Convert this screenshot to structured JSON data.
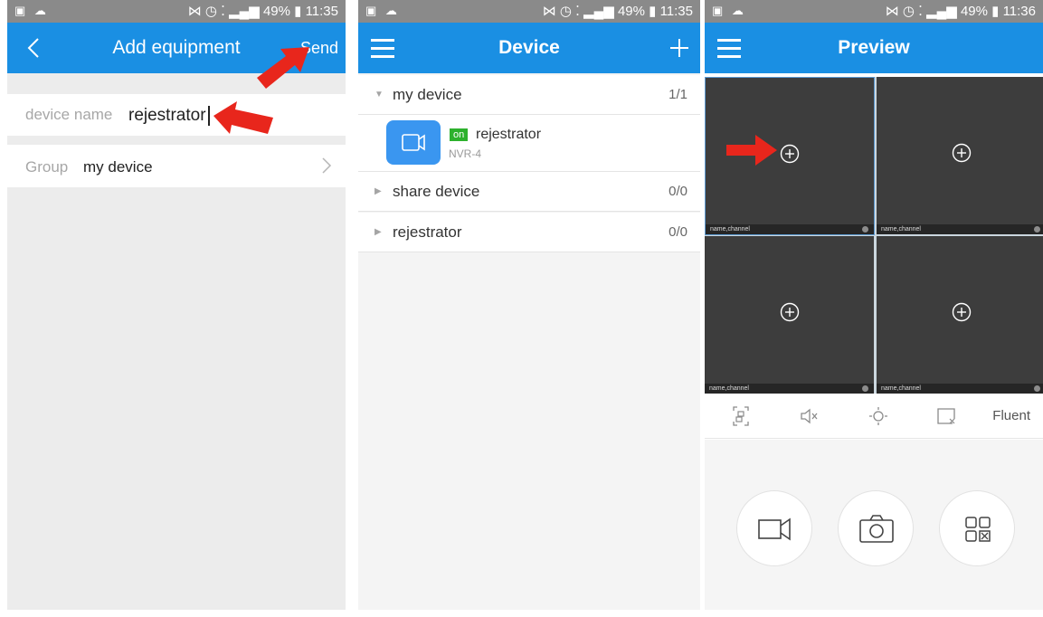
{
  "screens": [
    {
      "status": {
        "left_icons": "▣ ☁",
        "right_icons": "⋈ ◷ ⁚ ▂▄▆ 49% ▮",
        "time": "11:35"
      },
      "title": "Add equipment",
      "right_action": "Send",
      "fields": {
        "device_name": {
          "label": "device name",
          "value": "rejestrator"
        },
        "group": {
          "label": "Group",
          "value": "my device"
        }
      }
    },
    {
      "status": {
        "left_icons": "▣ ☁",
        "right_icons": "⋈ ◷ ⁚ ▂▄▆ 49% ▮",
        "time": "11:35"
      },
      "title": "Device",
      "groups": [
        {
          "label": "my device",
          "count": "1/1"
        },
        {
          "label": "share device",
          "count": "0/0"
        },
        {
          "label": "rejestrator",
          "count": "0/0"
        }
      ],
      "device": {
        "status": "on",
        "name": "rejestrator",
        "model": "NVR-4"
      }
    },
    {
      "status": {
        "left_icons": "▣ ☁",
        "right_icons": "⋈ ◷ ⁚ ▂▄▆ 49% ▮",
        "time": "11:36"
      },
      "title": "Preview",
      "cells": [
        {
          "caption": "name,channel"
        },
        {
          "caption": "name,channel"
        },
        {
          "caption": "name,channel"
        },
        {
          "caption": "name,channel"
        }
      ],
      "stream_quality": "Fluent"
    }
  ],
  "colors": {
    "accent": "#1a8fe3",
    "status_bar": "#8a8a8a",
    "online_badge": "#2db12d",
    "arrow": "#e8261c"
  }
}
